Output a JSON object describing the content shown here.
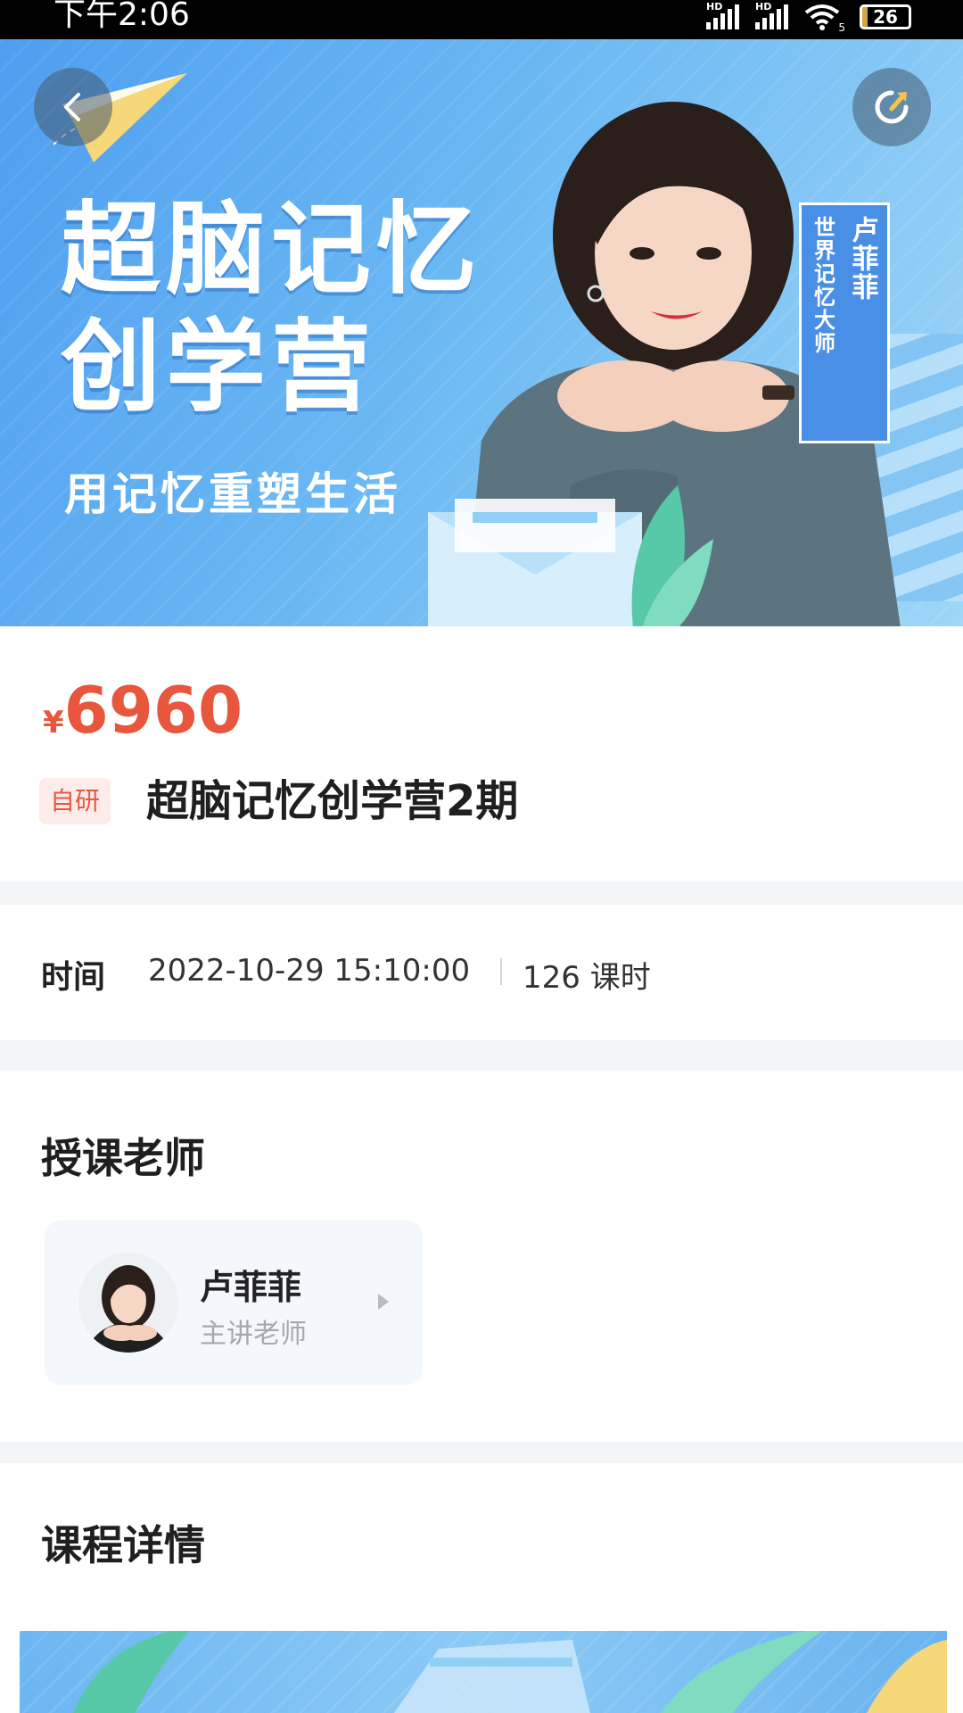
{
  "status_bar": {
    "time": "下午2:06",
    "network_1": "HD",
    "network_2": "HD",
    "wifi_sub": "5",
    "battery": "26"
  },
  "banner": {
    "title_line1": "超脑记忆",
    "title_line2": "创学营",
    "subtitle": "用记忆重塑生活",
    "name_tag_name": "卢菲菲",
    "name_tag_title": "世界记忆大师"
  },
  "course": {
    "currency": "¥",
    "price": "6960",
    "tag": "自研",
    "title": "超脑记忆创学营2期"
  },
  "schedule": {
    "label": "时间",
    "datetime": "2022-10-29 15:10:00",
    "hours": "126 课时"
  },
  "teachers": {
    "section_title": "授课老师",
    "items": [
      {
        "name": "卢菲菲",
        "role": "主讲老师"
      }
    ]
  },
  "details": {
    "section_title": "课程详情"
  },
  "colors": {
    "price": "#e8563e",
    "banner_blue": "#4f9ef0",
    "divider": "#f4f5f7"
  },
  "icons": {
    "back": "chevron-left-icon",
    "share": "share-icon",
    "teacher_arrow": "triangle-right-icon"
  }
}
